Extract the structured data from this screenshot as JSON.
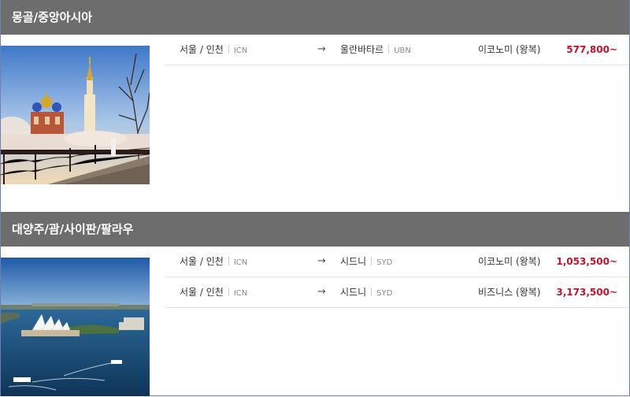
{
  "sections": [
    {
      "title": "몽골/중앙아시아",
      "routes": [
        {
          "from_city": "서울 / 인천",
          "from_code": "ICN",
          "arrow": "→",
          "to_city": "울란바타르",
          "to_code": "UBN",
          "cabin": "이코노미 (왕복)",
          "price": "577,800~"
        }
      ]
    },
    {
      "title": "대양주/괌/사이판/팔라우",
      "routes": [
        {
          "from_city": "서울 / 인천",
          "from_code": "ICN",
          "arrow": "→",
          "to_city": "시드니",
          "to_code": "SYD",
          "cabin": "이코노미 (왕복)",
          "price": "1,053,500~"
        },
        {
          "from_city": "서울 / 인천",
          "from_code": "ICN",
          "arrow": "→",
          "to_city": "시드니",
          "to_code": "SYD",
          "cabin": "비즈니스 (왕복)",
          "price": "3,173,500~"
        }
      ]
    }
  ],
  "colors": {
    "header_bg": "#6d6d6d",
    "price": "#c5112b",
    "border": "#6b7fb3"
  }
}
